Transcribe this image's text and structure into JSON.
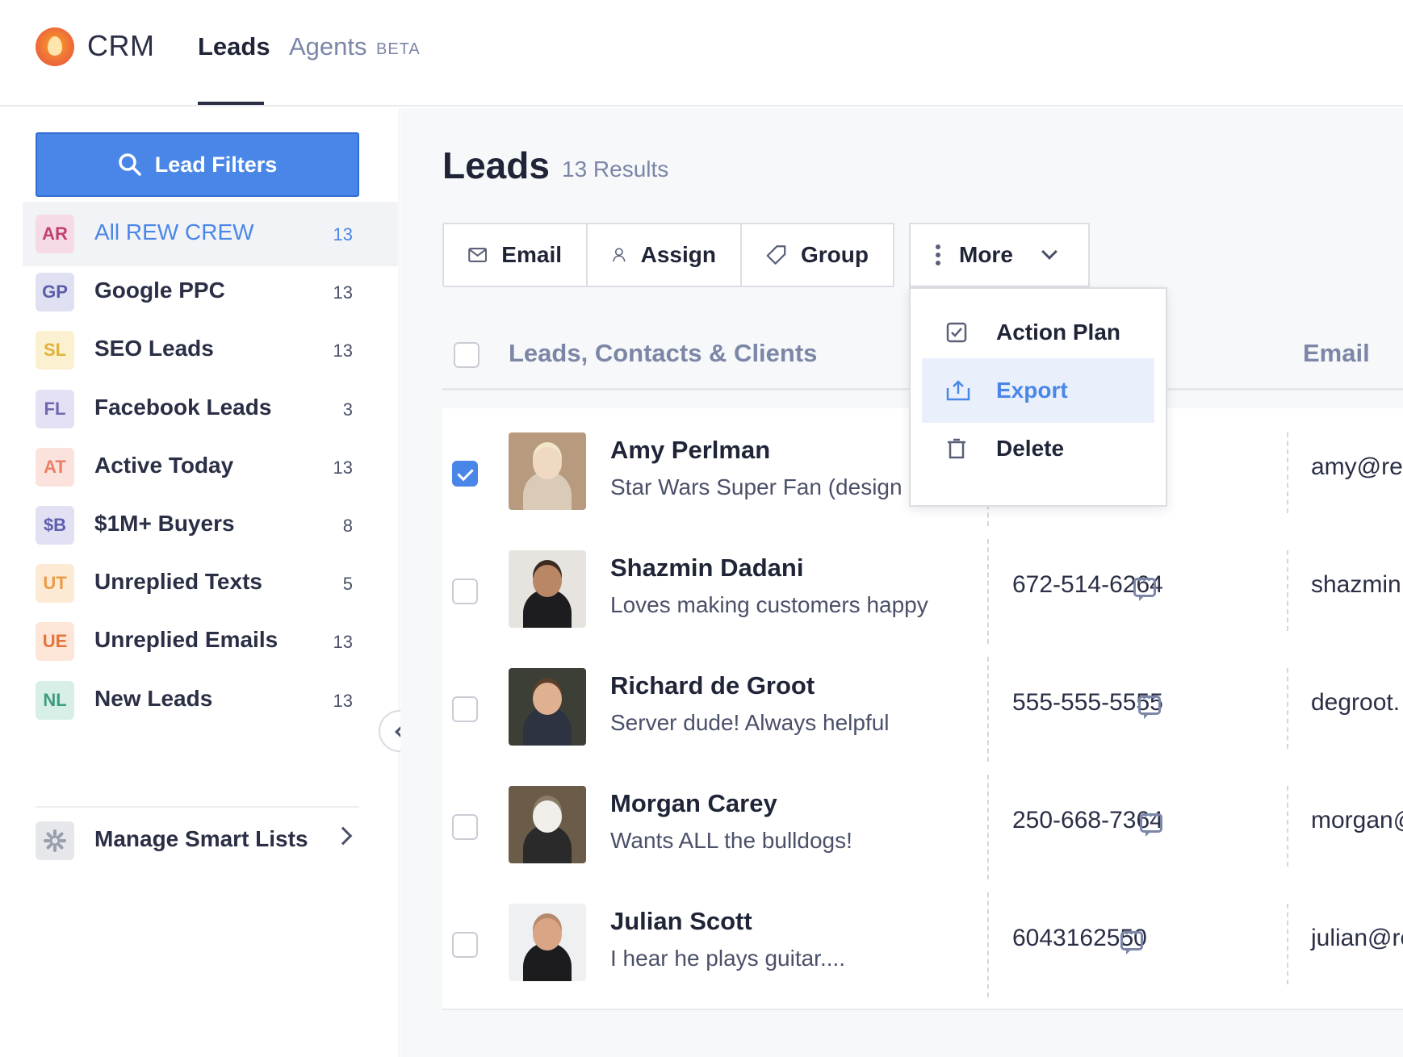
{
  "app": {
    "brand": "CRM"
  },
  "nav": {
    "tabs": [
      {
        "label": "Leads",
        "active": true
      },
      {
        "label": "Agents",
        "badge": "BETA",
        "active": false
      }
    ]
  },
  "sidebar": {
    "filter_button": "Lead Filters",
    "items": [
      {
        "initials": "AR",
        "label": "All REW CREW",
        "count": "13",
        "active": true,
        "badge_bg": "#f6dbe6",
        "badge_fg": "#c2406e"
      },
      {
        "initials": "GP",
        "label": "Google PPC",
        "count": "13",
        "badge_bg": "#dfe0f2",
        "badge_fg": "#5a5ea8"
      },
      {
        "initials": "SL",
        "label": "SEO Leads",
        "count": "13",
        "badge_bg": "#fbf0cf",
        "badge_fg": "#e1b23a"
      },
      {
        "initials": "FL",
        "label": "Facebook Leads",
        "count": "3",
        "badge_bg": "#e3e1f3",
        "badge_fg": "#6f68b0"
      },
      {
        "initials": "AT",
        "label": "Active Today",
        "count": "13",
        "badge_bg": "#fbe2dc",
        "badge_fg": "#ea7e66"
      },
      {
        "initials": "$B",
        "label": "$1M+ Buyers",
        "count": "8",
        "badge_bg": "#e1e1f3",
        "badge_fg": "#5e5fae"
      },
      {
        "initials": "UT",
        "label": "Unreplied Texts",
        "count": "5",
        "badge_bg": "#fcead5",
        "badge_fg": "#eb9b47"
      },
      {
        "initials": "UE",
        "label": "Unreplied Emails",
        "count": "13",
        "badge_bg": "#fde6d7",
        "badge_fg": "#e6733a"
      },
      {
        "initials": "NL",
        "label": "New Leads",
        "count": "13",
        "badge_bg": "#d8efe8",
        "badge_fg": "#3e9c80"
      }
    ],
    "manage_label": "Manage Smart Lists"
  },
  "main": {
    "title": "Leads",
    "results": "13 Results",
    "toolbar": {
      "email": "Email",
      "assign": "Assign",
      "group": "Group",
      "more": "More"
    },
    "dropdown": [
      {
        "label": "Action Plan",
        "icon": "checkbox-icon"
      },
      {
        "label": "Export",
        "icon": "export-icon",
        "active": true
      },
      {
        "label": "Delete",
        "icon": "trash-icon"
      }
    ],
    "table": {
      "col_leads": "Leads, Contacts & Clients",
      "col_email": "Email"
    },
    "leads": [
      {
        "name": "Amy Perlman",
        "note": "Star Wars Super Fan (design",
        "phone": "",
        "email": "amy@rev",
        "checked": true
      },
      {
        "name": "Shazmin Dadani",
        "note": "Loves making customers happy",
        "phone": "672-514-6264",
        "email": "shazmin",
        "checked": false
      },
      {
        "name": "Richard de Groot",
        "note": "Server dude! Always helpful",
        "phone": "555-555-5555",
        "email": "degroot.",
        "checked": false
      },
      {
        "name": "Morgan Carey",
        "note": "Wants ALL the bulldogs!",
        "phone": "250-668-7364",
        "email": "morgan@",
        "checked": false
      },
      {
        "name": "Julian Scott",
        "note": "I hear he plays guitar....",
        "phone": "6043162550",
        "email": "julian@re",
        "checked": false
      }
    ]
  },
  "colors": {
    "accent": "#4a86e8",
    "text": "#1f2537",
    "muted": "#7c86a7"
  }
}
